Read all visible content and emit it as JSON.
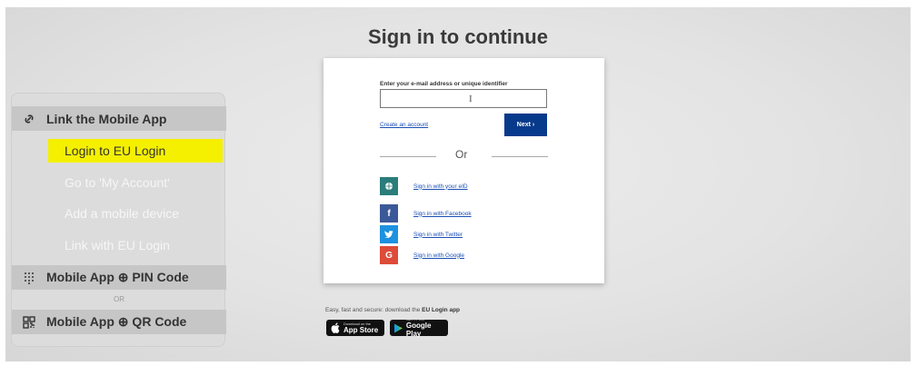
{
  "page": {
    "title": "Sign in to continue"
  },
  "sidebar": {
    "sections": [
      {
        "label": "Link the Mobile App",
        "icon": "link-icon"
      },
      {
        "label": "Mobile App ⊕ PIN Code",
        "icon": "keypad-icon"
      },
      {
        "label": "Mobile App ⊕ QR Code",
        "icon": "qr-code-icon"
      }
    ],
    "steps": [
      {
        "label": "Login to EU Login",
        "active": true
      },
      {
        "label": "Go to 'My Account'",
        "active": false
      },
      {
        "label": "Add a mobile device",
        "active": false
      },
      {
        "label": "Link with EU Login",
        "active": false
      }
    ],
    "or_label": "OR"
  },
  "login": {
    "field_label": "Enter your e-mail address or unique identifier",
    "email_value": "",
    "create_account": "Create an account",
    "next_label": "Next ›",
    "or_label": "Or",
    "providers": [
      {
        "label": "Sign in with your eID",
        "icon": "globe-icon",
        "color": "#2a7d7a",
        "glyph": "●"
      },
      {
        "label": "Sign in with Facebook",
        "icon": "facebook-icon",
        "color": "#3b5998",
        "glyph": "f"
      },
      {
        "label": "Sign in with Twitter",
        "icon": "twitter-icon",
        "color": "#1d91e0",
        "glyph": "❖"
      },
      {
        "label": "Sign in with Google",
        "icon": "google-icon",
        "color": "#dd4b39",
        "glyph": "G"
      }
    ]
  },
  "promo": {
    "text": "Easy, fast and secure: download the ",
    "app_name": "EU Login app",
    "app_store_small": "Download on the",
    "app_store_big": "App Store",
    "google_play_small": "GET IT ON",
    "google_play_big": "Google Play"
  },
  "colors": {
    "active_step": "#f5f000",
    "next_button": "#083a8c",
    "link": "#1a4fb5"
  }
}
